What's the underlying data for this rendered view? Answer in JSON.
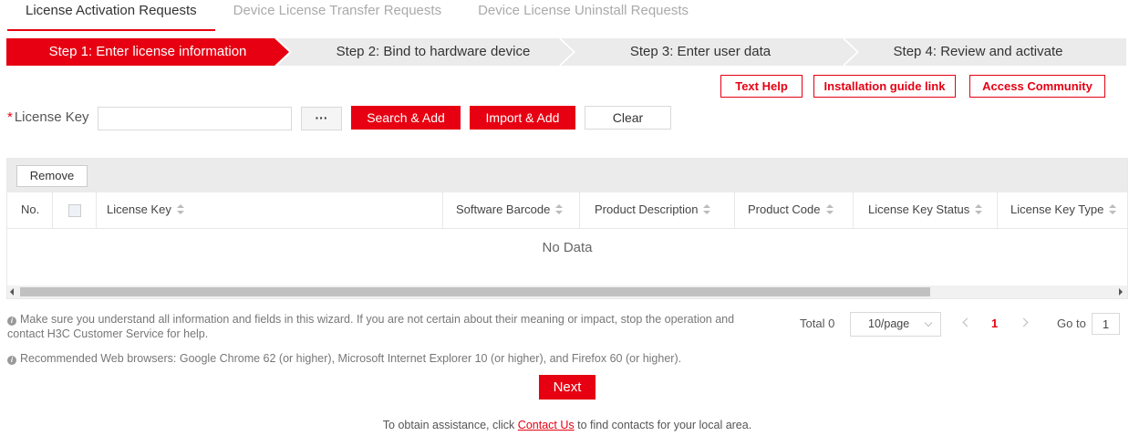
{
  "tabs": [
    {
      "label": "License Activation Requests",
      "active": true
    },
    {
      "label": "Device License Transfer Requests",
      "active": false
    },
    {
      "label": "Device License Uninstall Requests",
      "active": false
    }
  ],
  "steps": [
    {
      "label": "Step 1: Enter license information",
      "active": true
    },
    {
      "label": "Step 2: Bind to hardware device",
      "active": false
    },
    {
      "label": "Step 3: Enter user data",
      "active": false
    },
    {
      "label": "Step 4: Review and activate",
      "active": false
    }
  ],
  "colors": {
    "accent": "#e60012",
    "step_inactive": "#ebebeb"
  },
  "help": {
    "text_help": "Text Help",
    "installation_guide": "Installation guide link",
    "access_community": "Access Community"
  },
  "license": {
    "required_mark": "*",
    "label": "License Key",
    "input_value": "",
    "browse_label": "···",
    "search_add": "Search & Add",
    "import_add": "Import & Add",
    "clear": "Clear"
  },
  "table": {
    "remove": "Remove",
    "columns": [
      "No.",
      "",
      "License Key",
      "Software Barcode",
      "Product Description",
      "Product Code",
      "License Key Status",
      "License Key Type"
    ],
    "empty_text": "No Data"
  },
  "notes": {
    "note1_line1": "Make sure you understand all information and fields in this wizard. If you are not certain about their meaning or impact, stop the operation and",
    "note1_line2": "contact H3C Customer Service for help.",
    "note2": "Recommended Web browsers: Google Chrome 62 (or higher), Microsoft Internet Explorer 10 (or higher), and Firefox 60 (or higher)."
  },
  "pagination": {
    "total_label": "Total 0",
    "page_size": "10/page",
    "current_page": "1",
    "goto_label": "Go to",
    "goto_value": "1"
  },
  "next": "Next",
  "assist": {
    "before": "To obtain assistance, click ",
    "link": "Contact Us",
    "after": " to find contacts for your local area."
  }
}
